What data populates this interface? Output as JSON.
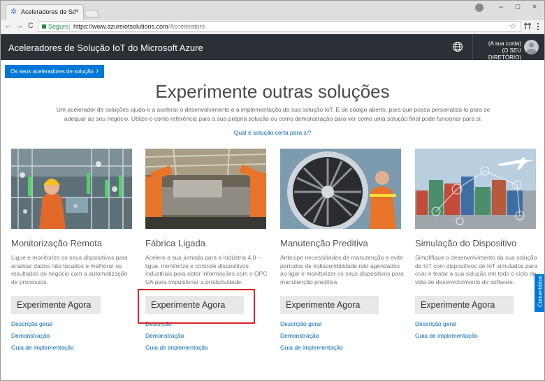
{
  "browser": {
    "tab_title": "Aceleradores de Soluçõe",
    "tab_close": "×",
    "nav_back": "←",
    "nav_forward": "→",
    "nav_reload": "C",
    "secure_label": "Seguro",
    "url_host": "https://www.azureiotsolutions.com",
    "url_path": "/Accelerators",
    "bookmark_star": "☆",
    "window_minimize": "–",
    "window_maximize": "□",
    "window_close": "×"
  },
  "header": {
    "title": "Aceleradores de Solução IoT do Microsoft Azure",
    "account_line1": "(A sua conta)",
    "account_line2": "(O SEU DIRETÓRIO)"
  },
  "main": {
    "back_button_label": "Os seus aceleradores de solução",
    "back_button_chevron": "›",
    "title": "Experimente outras soluções",
    "intro": "Um acelerador de soluções ajuda-o a acelerar o desenvolvimento e a implementação da sua solução IoT. É de código aberto, para que possa personalizá-lo para se adequar ao seu negócio. Utilize-o como referência para a sua própria solução ou como demonstração para ver como uma solução final pode funcionar para si.",
    "which_link": "Qual é solução certa para si?"
  },
  "cards": [
    {
      "title": "Monitorização Remota",
      "desc": "Ligue e monitorize os seus dispositivos para analisar dados não tocados e melhorar os resultados do negócio com a automatização de processos.",
      "button": "Experimente Agora",
      "links": [
        "Descrição geral",
        "Demonstração",
        "Guia de implementação"
      ]
    },
    {
      "title": "Fábrica Ligada",
      "desc": "Acelere a sua jornada para a Indústria 4.0 – ligue, monitorize e controle dispositivos industriais para obter informações com o OPC UA para impulsionar a produtividade.",
      "button": "Experimente Agora",
      "links": [
        "Descrição",
        "Demonstração",
        "Guia de implementação"
      ]
    },
    {
      "title": "Manutenção Preditiva",
      "desc": "Antecipe necessidades de manutenção e evite períodos de indisponibilidade não agendados ao ligar e monitorizar os seus dispositivos para manutenção preditiva.",
      "button": "Experimente Agora",
      "links": [
        "Descrição geral",
        "Demonstração",
        "Guia de implementação"
      ]
    },
    {
      "title": "Simulação do Dispositivo",
      "desc": "Simplifique o desenvolvimento da sua solução de IoT com dispositivos de IoT simulados para criar e testar a sua solução em todo o ciclo de vida de desenvolvimento de software.",
      "button": "Experimente Agora",
      "links": [
        "Descrição geral",
        "Guia de implementação"
      ]
    }
  ],
  "feedback_tab": "Comentários",
  "colors": {
    "header_bg": "#2b2f36",
    "accent_blue": "#0078d7",
    "link_blue": "#0067b8",
    "highlight_red": "#e01e25"
  }
}
